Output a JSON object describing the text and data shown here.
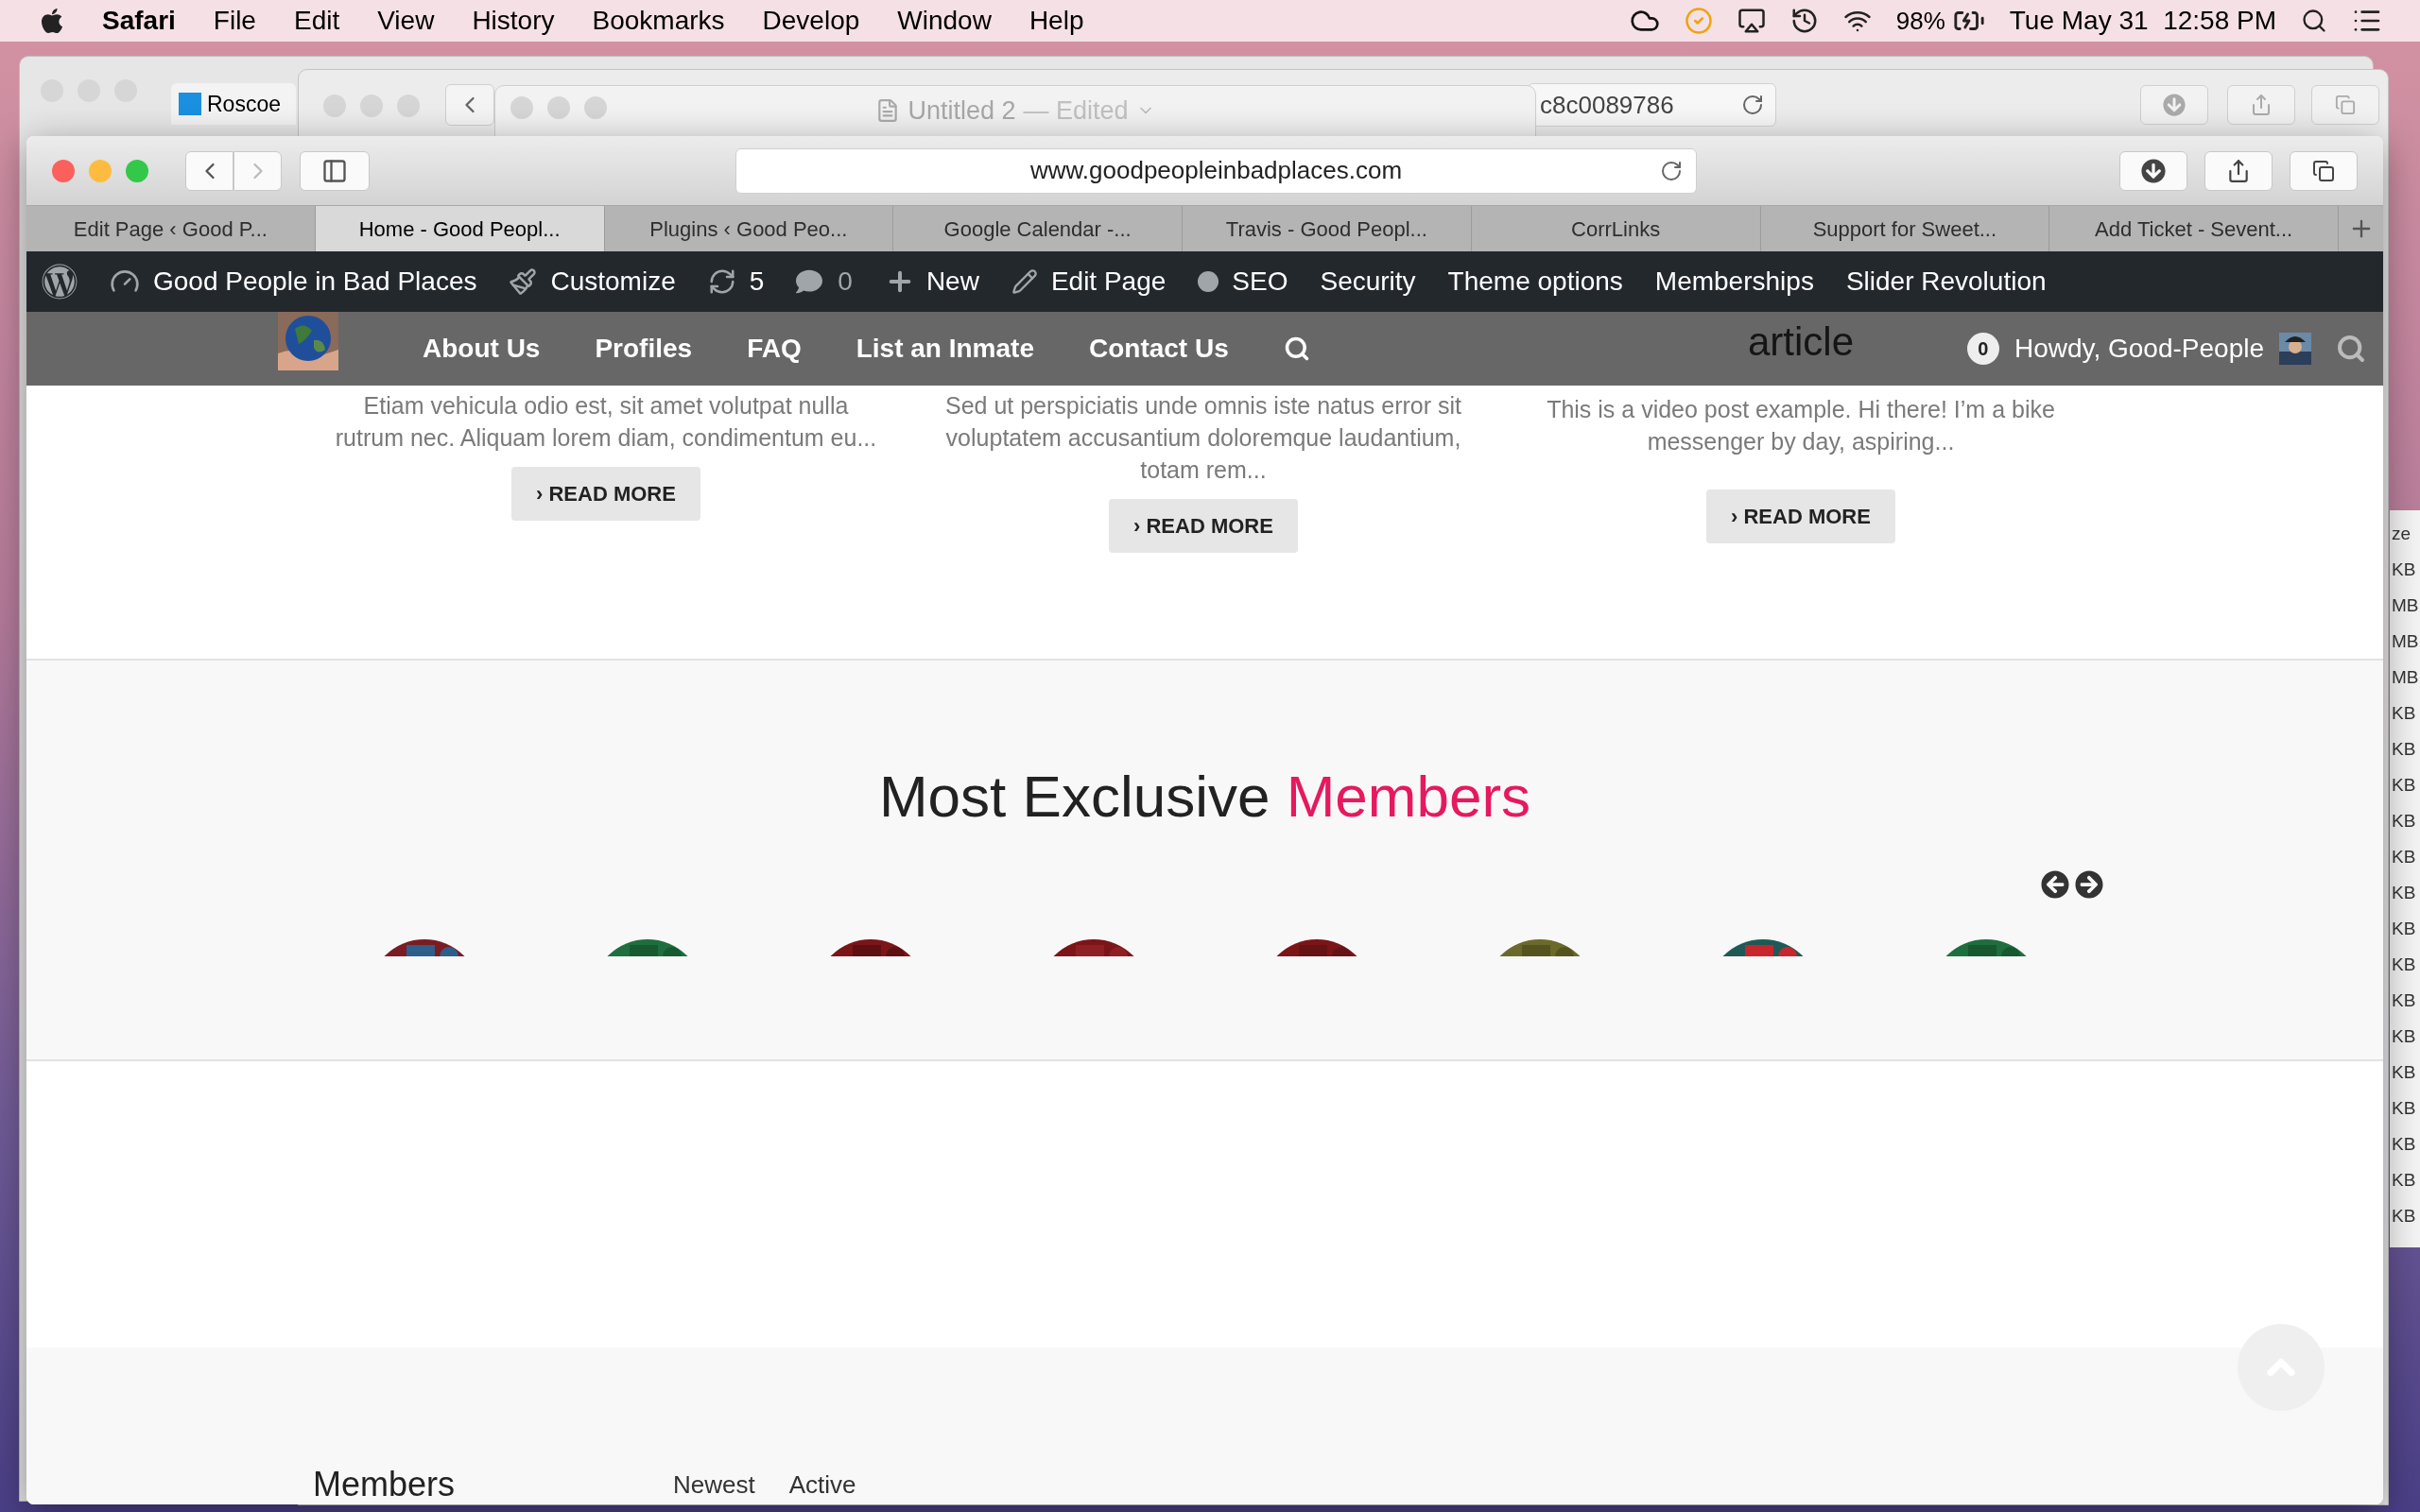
{
  "menu_bar": {
    "app": "Safari",
    "menus": [
      "File",
      "Edit",
      "View",
      "History",
      "Bookmarks",
      "Develop",
      "Window",
      "Help"
    ],
    "battery": "98%",
    "clock": "Tue May 31  12:58 PM"
  },
  "back_windows": [
    {
      "kind": "tabbed",
      "tab": "Roscoe"
    },
    {
      "kind": "document",
      "title": "Untitled 2",
      "status": "— Edited"
    },
    {
      "kind": "browser",
      "address": "c8c0089786"
    }
  ],
  "side_window": {
    "column_header": "ze",
    "sizes": [
      "KB",
      "MB",
      "MB",
      "MB",
      "KB",
      "KB",
      "KB",
      "KB",
      "KB",
      "KB",
      "KB",
      "KB",
      "KB",
      "KB",
      "KB",
      "KB",
      "KB",
      "KB",
      "KB"
    ]
  },
  "browser": {
    "address": "www.goodpeopleinbadplaces.com",
    "tabs": [
      {
        "label": "Edit Page ‹ Good P...",
        "selected": false
      },
      {
        "label": "Home - Good Peopl...",
        "selected": true
      },
      {
        "label": "Plugins ‹ Good Peo...",
        "selected": false
      },
      {
        "label": "Google Calendar -...",
        "selected": false
      },
      {
        "label": "Travis - Good Peopl...",
        "selected": false
      },
      {
        "label": "CorrLinks",
        "selected": false
      },
      {
        "label": "Support for Sweet...",
        "selected": false
      },
      {
        "label": "Add Ticket - Sevent...",
        "selected": false
      }
    ]
  },
  "admin_bar": {
    "site": "Good People in Bad Places",
    "items": [
      {
        "kind": "customize",
        "label": "Customize"
      },
      {
        "kind": "updates",
        "label": "5"
      },
      {
        "kind": "comments",
        "label": "0"
      },
      {
        "kind": "new",
        "label": "New"
      },
      {
        "kind": "edit",
        "label": "Edit Page"
      },
      {
        "kind": "seo",
        "label": "SEO"
      },
      {
        "kind": "text",
        "label": "Security"
      },
      {
        "kind": "text",
        "label": "Theme options"
      },
      {
        "kind": "text",
        "label": "Memberships"
      },
      {
        "kind": "text",
        "label": "Slider Revolution"
      }
    ]
  },
  "site_nav": {
    "links": [
      "About Us",
      "Profiles",
      "FAQ",
      "List an Inmate",
      "Contact Us"
    ],
    "cart_count": "0",
    "greeting": "Howdy, Good-People"
  },
  "posts": [
    {
      "excerpt": "Etiam vehicula odio est, sit amet volutpat nulla rutrum nec. Aliquam lorem diam, condimentum eu...",
      "button": "› READ MORE"
    },
    {
      "excerpt": "Sed ut perspiciatis unde omnis iste natus error sit voluptatem accusantium doloremque laudantium, totam rem...",
      "button": "› READ MORE"
    },
    {
      "title": "article",
      "excerpt": "This is a video post example. Hi there! I’m a bike messenger by day, aspiring...",
      "button": "› READ MORE"
    }
  ],
  "members_section": {
    "heading": "Most Exclusive",
    "highlight": "Members"
  },
  "footer": {
    "title": "Members",
    "filters": [
      "Newest",
      "Active"
    ]
  }
}
